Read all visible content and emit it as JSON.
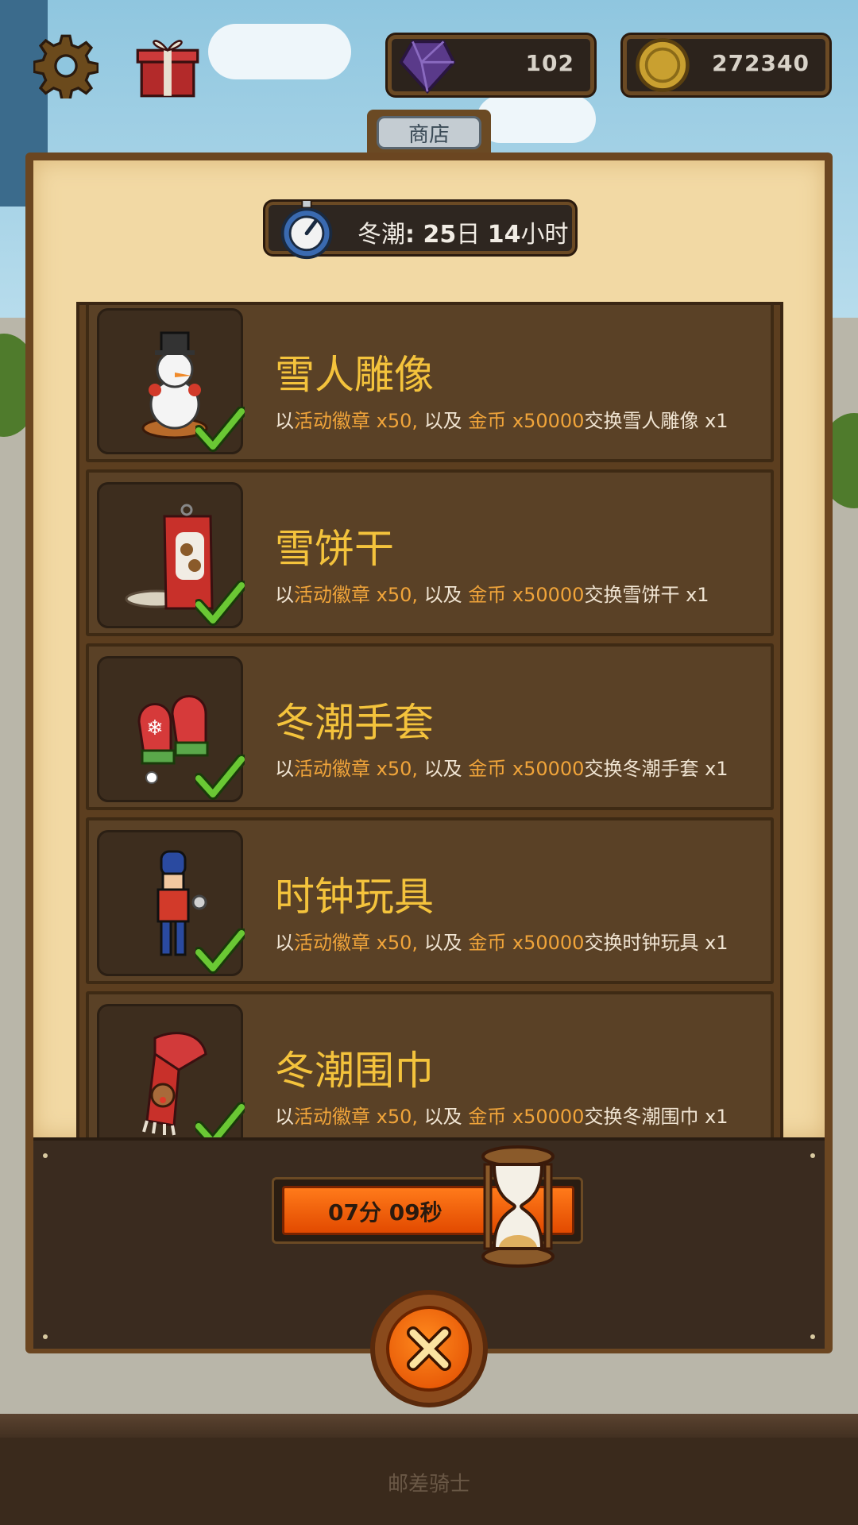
{
  "hud": {
    "gems": "102",
    "coins": "272340",
    "icons": [
      "gear-icon",
      "gift-icon",
      "gem-icon",
      "coin-icon"
    ]
  },
  "shop": {
    "tab_label": "商店",
    "event_timer": {
      "prefix": "冬潮",
      "days": "25",
      "days_unit": "日",
      "hours": "14",
      "hours_unit": "小时"
    },
    "items": [
      {
        "title": "雪人雕像",
        "desc_prefix": "以",
        "badge": "活动徽章 x50,",
        "mid": " 以及 ",
        "gold": "金币 x50000",
        "suffix": "交换雪人雕像 x1",
        "purchased": true
      },
      {
        "title": "雪饼干",
        "desc_prefix": "以",
        "badge": "活动徽章 x50,",
        "mid": " 以及 ",
        "gold": "金币 x50000",
        "suffix": "交换雪饼干 x1",
        "purchased": true
      },
      {
        "title": "冬潮手套",
        "desc_prefix": "以",
        "badge": "活动徽章 x50,",
        "mid": " 以及 ",
        "gold": "金币 x50000",
        "suffix": "交换冬潮手套 x1",
        "purchased": true
      },
      {
        "title": "时钟玩具",
        "desc_prefix": "以",
        "badge": "活动徽章 x50,",
        "mid": " 以及 ",
        "gold": "金币 x50000",
        "suffix": "交换时钟玩具 x1",
        "purchased": true
      },
      {
        "title": "冬潮围巾",
        "desc_prefix": "以",
        "badge": "活动徽章 x50,",
        "mid": " 以及 ",
        "gold": "金币 x50000",
        "suffix": "交换冬潮围巾 x1",
        "purchased": true
      }
    ],
    "refresh_timer": "07分 09秒"
  },
  "footer": {
    "text": "邮差骑士"
  },
  "colors": {
    "title": "#f4c33c",
    "highlight": "#f0a43a",
    "accent_orange": "#e24a00"
  }
}
